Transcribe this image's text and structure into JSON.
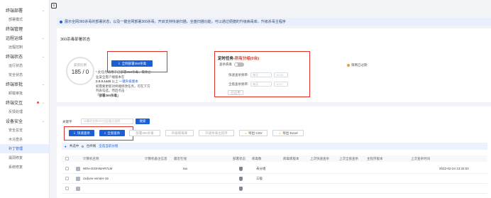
{
  "sidebar": {
    "groups": [
      {
        "label": "终端部署",
        "dot": false,
        "items": [
          "部署模式"
        ]
      },
      {
        "label": "终端管理",
        "dot": false,
        "items": []
      },
      {
        "label": "远程运维",
        "dot": false,
        "items": [
          "远程控制"
        ]
      },
      {
        "label": "终端状态",
        "dot": false,
        "items": [
          "运行状态",
          "安全状态"
        ]
      },
      {
        "label": "终端审批",
        "dot": false,
        "items": [
          "卸载审批"
        ]
      },
      {
        "label": "终端交互",
        "dot": true,
        "items": [
          "反馈处理"
        ]
      },
      {
        "label": "设备安全",
        "dot": false,
        "items": [
          "安全总览",
          "木马查杀",
          "补丁管理",
          "漏洞修复",
          "系统修复"
        ]
      }
    ],
    "active_item": "补丁管理"
  },
  "notice": {
    "text": "展示全网360杀毒的部署状态，以及一键全网部署360杀毒，开启支持快速扫描，全盘扫描功能，可以通过便捷的升级病毒库，升级杀毒主程序"
  },
  "status_panel": {
    "title": "360杀毒部署状态",
    "circle_label": "安装比例",
    "circle_value": "185 / 0",
    "deploy_button": "全网部署360杀毒",
    "desc_line1": "* 此任务适用于已部署360",
    "desc_line2": "杀毒，需要企业安全客户端版本在",
    "desc_version": "2.0.0.1440",
    "desc_above": "以上",
    "desc_upgrade_link": "一键升级版本",
    "desc_line3": "如需要更新对终端修改任务，可在下方列表勾选，然后点击",
    "desc_quote": "「部署360杀毒」"
  },
  "schedule": {
    "title_prefix": "定时任务-",
    "title_red": "所有分组(0台)",
    "toggle_label": "查杀病毒",
    "quick_label": "快速查杀频率:",
    "full_label": "全盘查杀频率:",
    "freq_placeholder": "每天",
    "time_placeholder": "10:00",
    "time_placeholder2": "10:17",
    "save_button": "已应用"
  },
  "strategy_label": "策略已过期",
  "list": {
    "search_label": "关键字",
    "search_placeholder": "计算机名称/IP/分组/备注说明",
    "search_button": "搜索",
    "quick_scan": "快速查杀",
    "full_scan": "全盘查杀",
    "deploy": "部署360杀毒",
    "upgrade_db": "升级病毒库",
    "upgrade_main": "升级杀毒主程序",
    "export_csv": "导出 CSV",
    "export_excel": "导出 Excel",
    "selected_text": "共选中",
    "selected_count": "0",
    "selected_unit": "台终端",
    "select_all_link": "全选当前分组",
    "columns": [
      "计算机名称",
      "计算机备注信息",
      "最近在线",
      "部署状态",
      "病毒数",
      "病毒库版本",
      "上次快速查杀",
      "上次全盘查杀",
      "主程序版本",
      "上次查杀时间"
    ],
    "rows": [
      {
        "name": "WIN-4SOHMAR7LM",
        "online": "tao",
        "status": "未分组",
        "last": "2022-02-24 13:32:04"
      },
      {
        "name": "zxdcen-vsmter-19",
        "online": "",
        "status": "三级",
        "last": ""
      },
      {
        "name": "",
        "online": "",
        "status": "",
        "last": ""
      }
    ]
  }
}
